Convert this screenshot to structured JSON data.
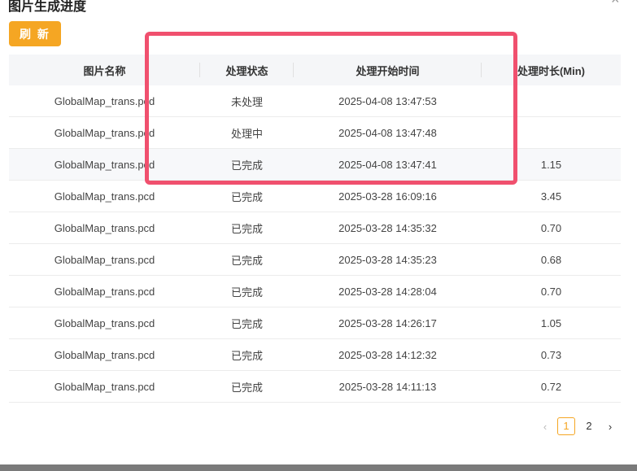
{
  "dialog": {
    "title": "图片生成进度",
    "close_icon": "close-icon"
  },
  "toolbar": {
    "refresh_label": "刷 新"
  },
  "table": {
    "headers": [
      "图片名称",
      "处理状态",
      "处理开始时间",
      "处理时长(Min)"
    ],
    "rows": [
      {
        "name": "GlobalMap_trans.pcd",
        "status": "未处理",
        "status_type": "pending",
        "start": "2025-04-08 13:47:53",
        "duration": ""
      },
      {
        "name": "GlobalMap_trans.pcd",
        "status": "处理中",
        "status_type": "processing",
        "start": "2025-04-08 13:47:48",
        "duration": ""
      },
      {
        "name": "GlobalMap_trans.pcd",
        "status": "已完成",
        "status_type": "done",
        "start": "2025-04-08 13:47:41",
        "duration": "1.15"
      },
      {
        "name": "GlobalMap_trans.pcd",
        "status": "已完成",
        "status_type": "done",
        "start": "2025-03-28 16:09:16",
        "duration": "3.45"
      },
      {
        "name": "GlobalMap_trans.pcd",
        "status": "已完成",
        "status_type": "done",
        "start": "2025-03-28 14:35:32",
        "duration": "0.70"
      },
      {
        "name": "GlobalMap_trans.pcd",
        "status": "已完成",
        "status_type": "done",
        "start": "2025-03-28 14:35:23",
        "duration": "0.68"
      },
      {
        "name": "GlobalMap_trans.pcd",
        "status": "已完成",
        "status_type": "done",
        "start": "2025-03-28 14:28:04",
        "duration": "0.70"
      },
      {
        "name": "GlobalMap_trans.pcd",
        "status": "已完成",
        "status_type": "done",
        "start": "2025-03-28 14:26:17",
        "duration": "1.05"
      },
      {
        "name": "GlobalMap_trans.pcd",
        "status": "已完成",
        "status_type": "done",
        "start": "2025-03-28 14:12:32",
        "duration": "0.73"
      },
      {
        "name": "GlobalMap_trans.pcd",
        "status": "已完成",
        "status_type": "done",
        "start": "2025-03-28 14:11:13",
        "duration": "0.72"
      }
    ]
  },
  "pagination": {
    "pages": [
      "1",
      "2"
    ],
    "current": "1"
  },
  "colors": {
    "accent": "#f5a623",
    "pending": "#e02020",
    "processing": "#1a8f1a",
    "highlight_box": "#f0506e"
  }
}
